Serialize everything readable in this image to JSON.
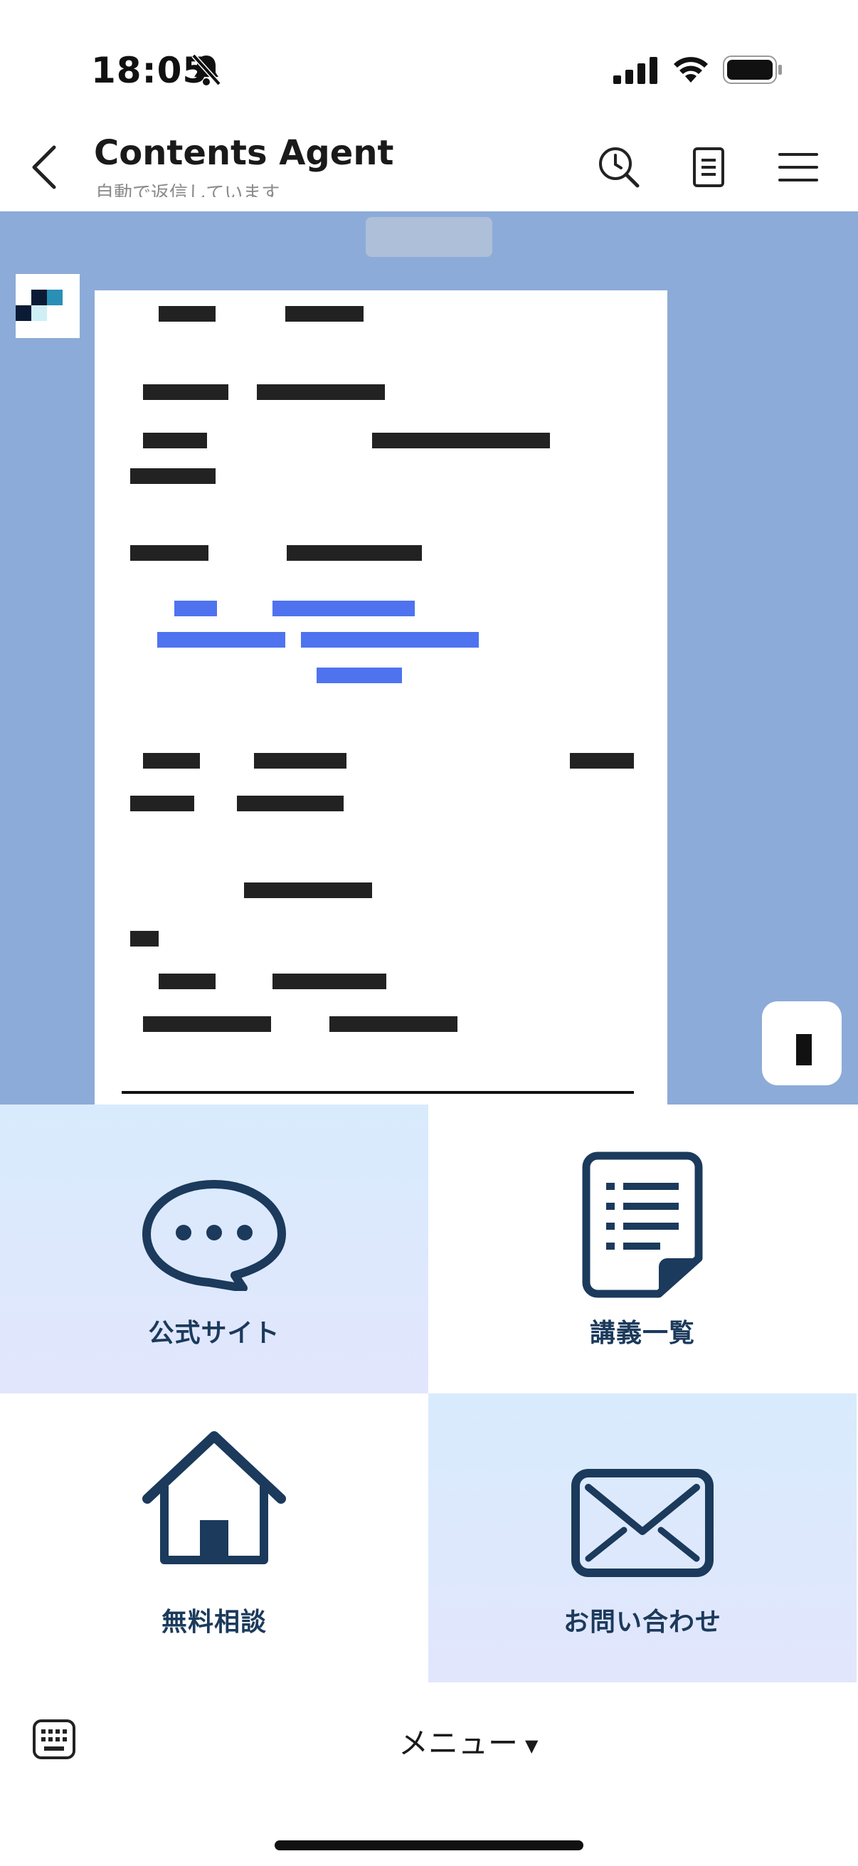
{
  "status_bar": {
    "time": "18:05"
  },
  "header": {
    "title": "Contents Agent",
    "subtitle": "自動で返信しています"
  },
  "rich_menu": {
    "tiles": [
      {
        "label": "公式サイト",
        "icon": "speech-bubble-icon"
      },
      {
        "label": "講義一覧",
        "icon": "document-list-icon"
      },
      {
        "label": "無料相談",
        "icon": "home-icon"
      },
      {
        "label": "お問い合わせ",
        "icon": "mail-icon"
      }
    ]
  },
  "bottom_bar": {
    "menu_label": "メニュー"
  },
  "colors": {
    "chat_bg": "#8cabd8",
    "menu_icon": "#1b3a5c",
    "link_blue": "#4f73ef"
  }
}
